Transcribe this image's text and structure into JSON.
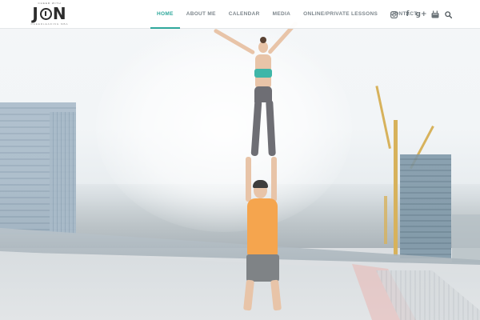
{
  "site": {
    "logo": {
      "tagline": "CHEER WITH",
      "wordmark": "JON",
      "subtitle": "CHEERLEADING MBA"
    }
  },
  "nav": {
    "items": [
      {
        "label": "HOME",
        "active": true
      },
      {
        "label": "ABOUT ME",
        "active": false
      },
      {
        "label": "CALENDAR",
        "active": false
      },
      {
        "label": "MEDIA",
        "active": false
      },
      {
        "label": "ONLINE/PRIVATE LESSONS",
        "active": false
      },
      {
        "label": "CONTACT",
        "active": false
      }
    ]
  },
  "social": {
    "icons": [
      "instagram-icon",
      "facebook-icon",
      "google-plus-icon",
      "youtube-icon",
      "search-icon"
    ],
    "google_plus_text": "g+",
    "facebook_text": "f"
  },
  "theme": {
    "accent": "#2fa89c",
    "nav_text": "#7d868c"
  }
}
